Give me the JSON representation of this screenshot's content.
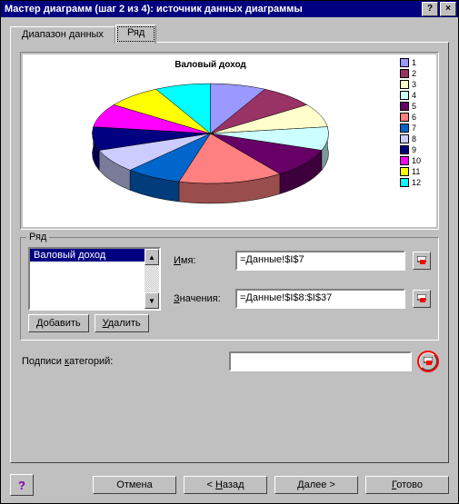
{
  "window": {
    "title": "Мастер диаграмм (шаг 2 из 4): источник данных диаграммы",
    "help_btn": "?",
    "close_btn": "×"
  },
  "tabs": {
    "data_range": "Диапазон данных",
    "series": "Ряд"
  },
  "chart_data": {
    "type": "pie",
    "title": "Валовый доход",
    "series_name": "Валовый доход",
    "categories": [
      "1",
      "2",
      "3",
      "4",
      "5",
      "6",
      "7",
      "8",
      "9",
      "10",
      "11",
      "12"
    ],
    "values": [
      8,
      8,
      8,
      8,
      10,
      15,
      8,
      8,
      8,
      8,
      8,
      8
    ],
    "colors": [
      "#9999ff",
      "#993366",
      "#ffffcc",
      "#ccffff",
      "#660066",
      "#ff8080",
      "#0066cc",
      "#ccccff",
      "#000080",
      "#ff00ff",
      "#ffff00",
      "#00ffff"
    ]
  },
  "series_group": {
    "label": "Ряд",
    "list": [
      "Валовый доход"
    ],
    "selected_index": 0,
    "add_label": "Добавить",
    "remove_label": "Удалить",
    "name_label": "Имя:",
    "name_value": "=Данные!$I$7",
    "values_label": "Значения:",
    "values_value": "=Данные!$I$8:$I$37"
  },
  "category_labels": {
    "label": "Подписи категорий:",
    "value": ""
  },
  "footer": {
    "help_icon": "?",
    "cancel": "Отмена",
    "back": "< Назад",
    "next": "Далее >",
    "finish": "Готово"
  },
  "icons": {
    "range_select": "range-select-icon"
  }
}
